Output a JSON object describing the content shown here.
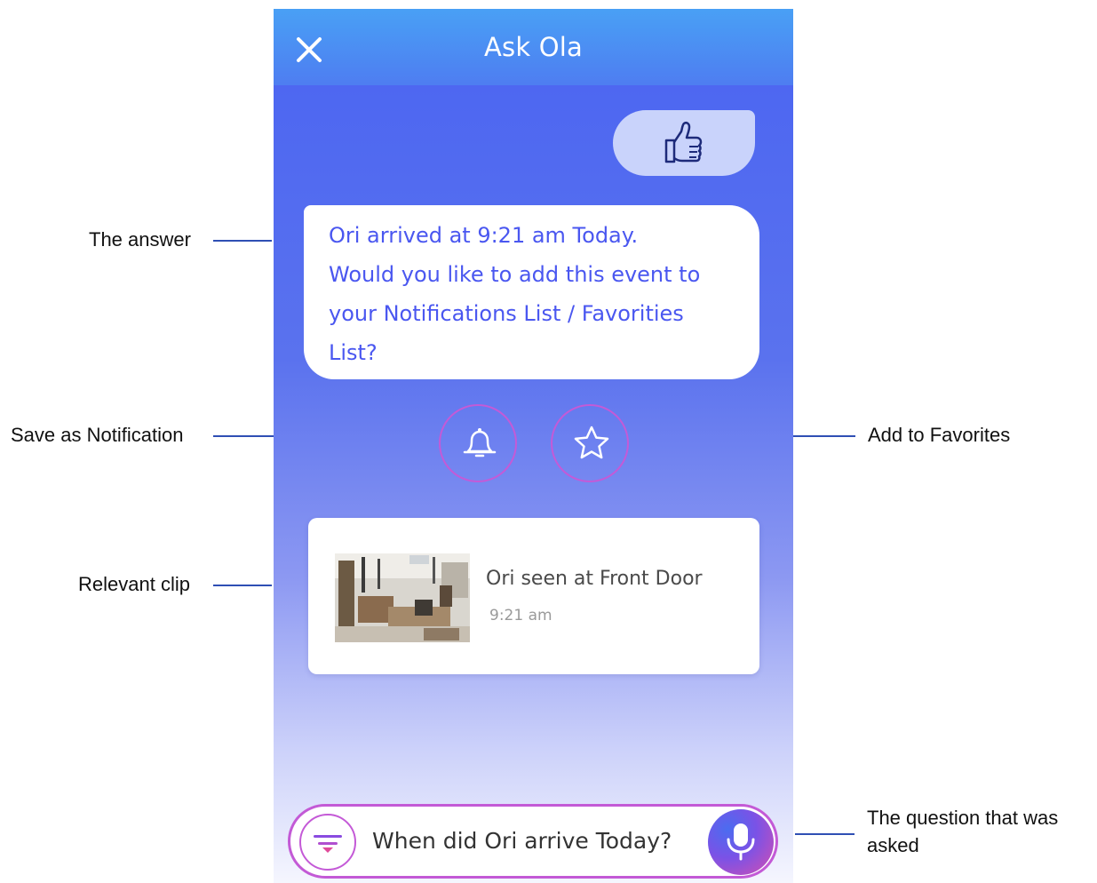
{
  "header": {
    "title": "Ask Ola"
  },
  "user_message": {
    "icon": "thumbs-up-icon"
  },
  "answer": {
    "lines": [
      "Ori arrived at 9:21 am Today.",
      "Would you like to add this event to",
      "your Notifications List / Favorities",
      "List?"
    ]
  },
  "actions": {
    "notification_icon": "bell-icon",
    "favorite_icon": "star-icon"
  },
  "clip": {
    "title": "Ori seen at Front Door",
    "time": "9:21 am"
  },
  "ask_bar": {
    "question": "When did Ori arrive Today?",
    "filter_icon": "filter-icon",
    "mic_icon": "microphone-icon"
  },
  "annotations": {
    "answer": "The answer",
    "save_notification": "Save as Notification",
    "add_favorites": "Add to Favorites",
    "relevant_clip": "Relevant clip",
    "question_line1": "The question that was",
    "question_line2": "asked"
  },
  "colors": {
    "accent_purple": "#c45ad7",
    "answer_text": "#4a57f0",
    "header_start": "#49a0f5",
    "header_end": "#4e7df1"
  }
}
